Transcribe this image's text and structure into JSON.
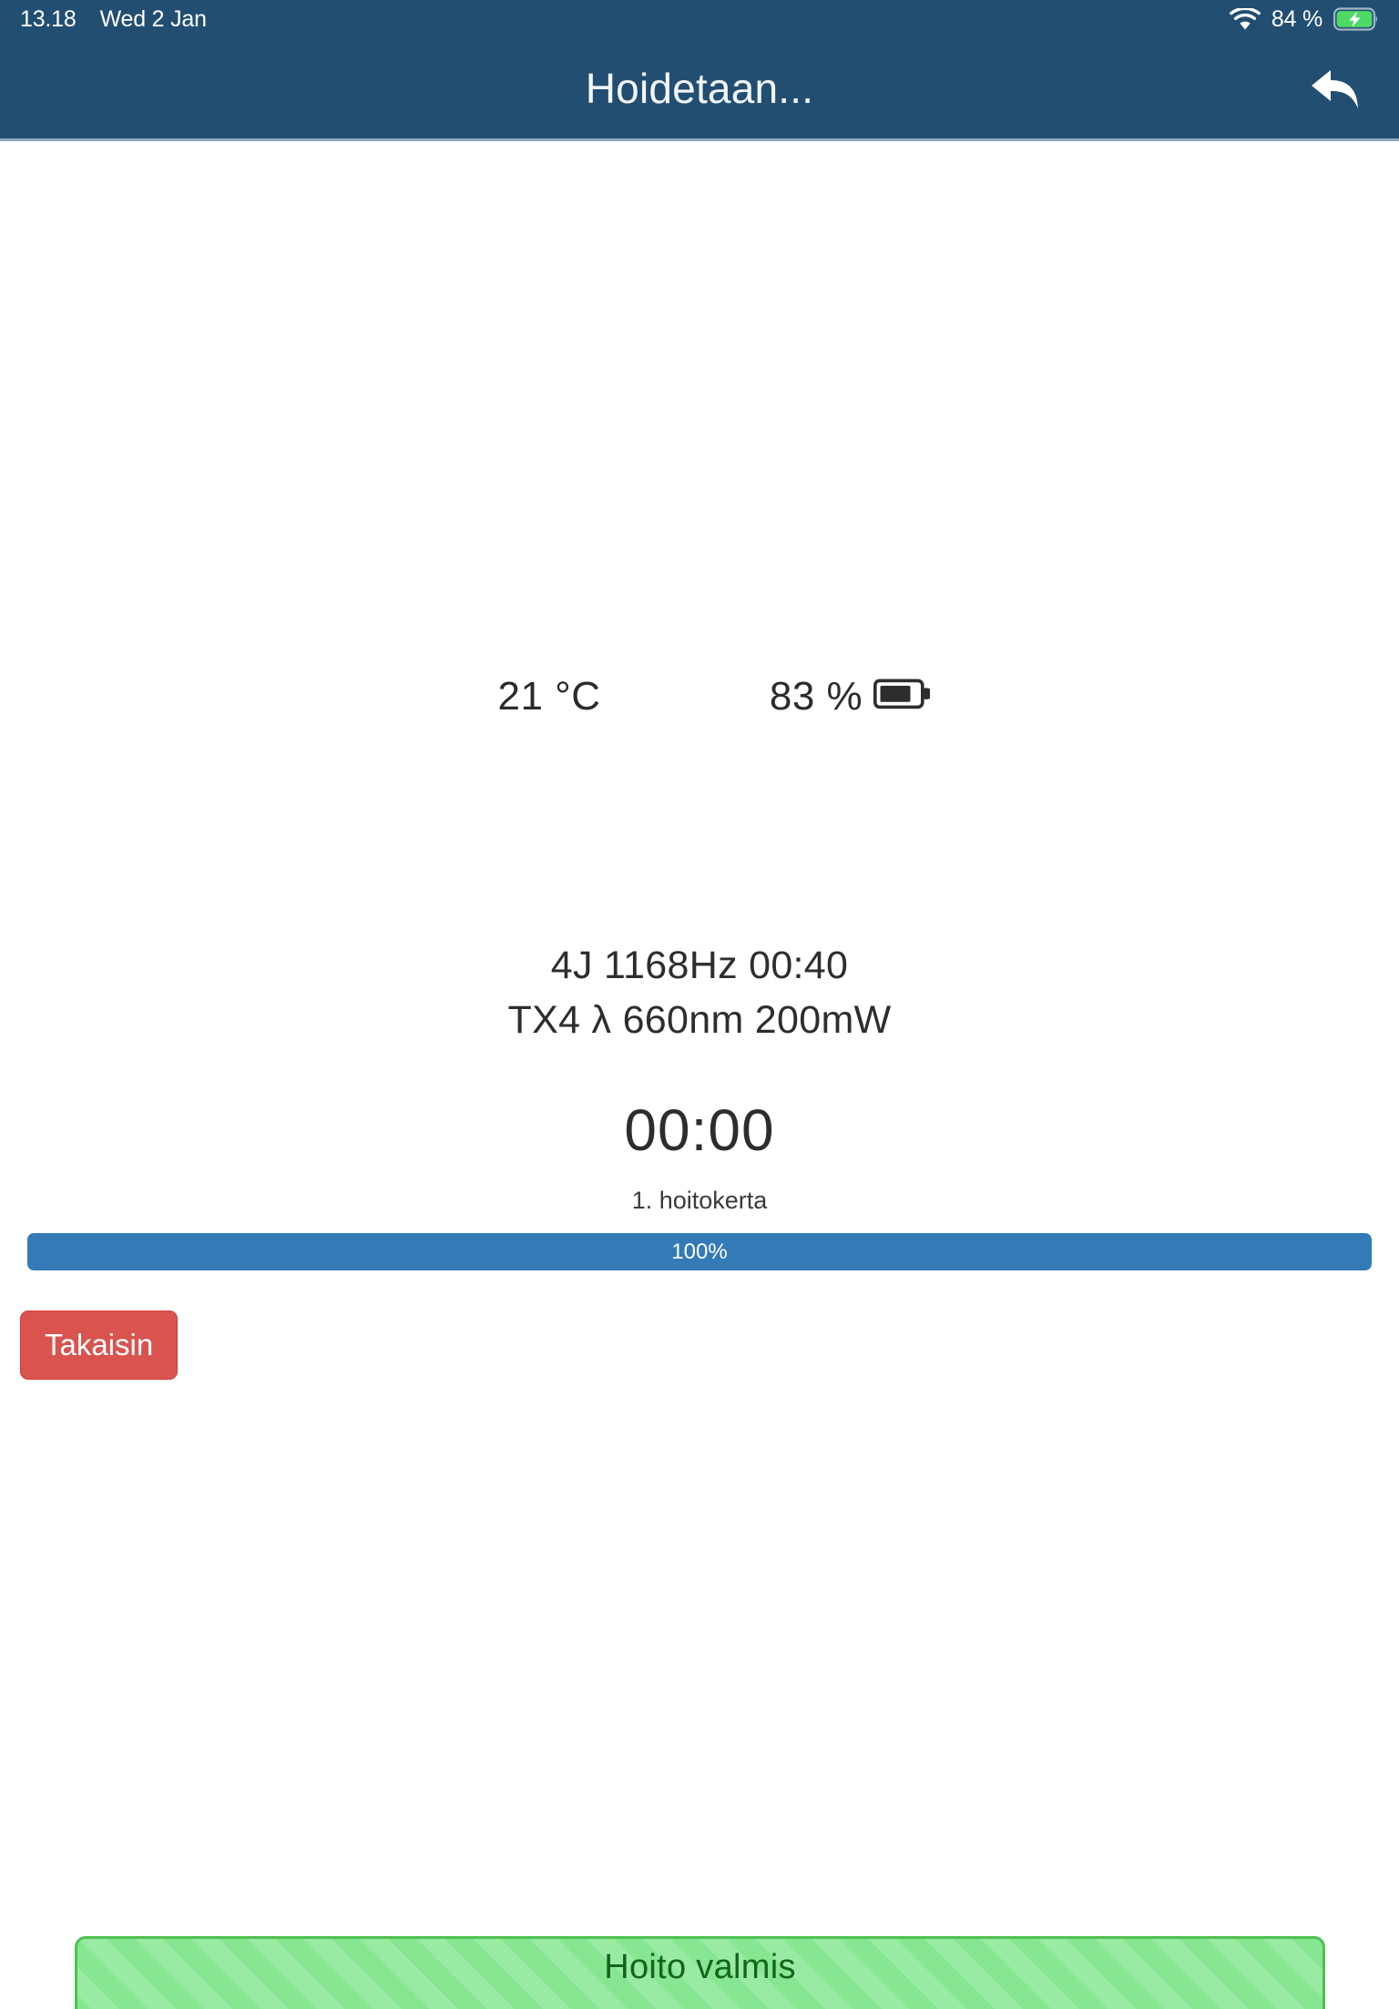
{
  "status_bar": {
    "time": "13.18",
    "date": "Wed 2 Jan",
    "wifi_icon": "wifi-icon",
    "battery_percent": "84 %",
    "battery_icon": "battery-charging-icon",
    "battery_level": 84,
    "background_color": "#224e72"
  },
  "nav_bar": {
    "title": "Hoidetaan...",
    "back_icon": "back-arrow-icon",
    "background_color": "#224e72"
  },
  "main": {
    "temperature": "21 °C",
    "device_battery_percent": "83 %",
    "device_battery_level": 83,
    "device_battery_icon": "battery-icon",
    "param_line_1": "4J 1168Hz 00:40",
    "param_line_2": "TX4 λ 660nm 200mW",
    "timer": "00:00",
    "session_label": "1. hoitokerta",
    "progress": {
      "label": "100%",
      "value": 100,
      "color": "#337ab7"
    },
    "back_button_label": "Takaisin",
    "back_button_color": "#d9534f"
  },
  "alert": {
    "message": "Hoito valmis",
    "background_color": "#86e691",
    "border_color": "#4fc14f",
    "text_color": "#14641c"
  }
}
